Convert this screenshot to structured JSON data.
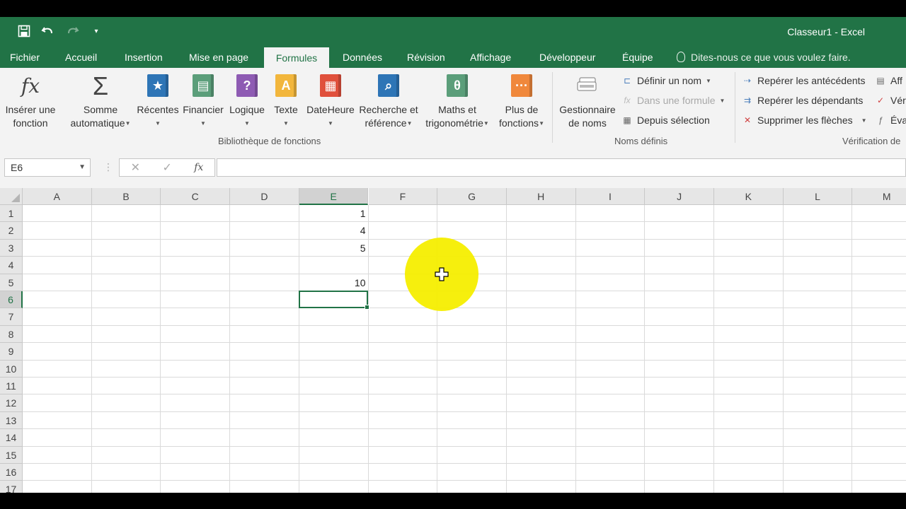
{
  "window": {
    "title": "Classeur1 - Excel"
  },
  "tabs": [
    {
      "label": "Fichier"
    },
    {
      "label": "Accueil"
    },
    {
      "label": "Insertion"
    },
    {
      "label": "Mise en page"
    },
    {
      "label": "Formules"
    },
    {
      "label": "Données"
    },
    {
      "label": "Révision"
    },
    {
      "label": "Affichage"
    },
    {
      "label": "Développeur"
    },
    {
      "label": "Équipe"
    }
  ],
  "active_tab": "Formules",
  "tell_me": "Dites-nous ce que vous voulez faire.",
  "ribbon": {
    "insert_function": {
      "line1": "Insérer une",
      "line2": "fonction"
    },
    "autosum": {
      "line1": "Somme",
      "line2": "automatique"
    },
    "recent": {
      "label": "Récentes"
    },
    "financial": {
      "label": "Financier"
    },
    "logical": {
      "label": "Logique"
    },
    "text": {
      "label": "Texte"
    },
    "datetime": {
      "label": "DateHeure"
    },
    "lookup": {
      "line1": "Recherche et",
      "line2": "référence"
    },
    "math": {
      "line1": "Maths et",
      "line2": "trigonométrie"
    },
    "more": {
      "line1": "Plus de",
      "line2": "fonctions"
    },
    "library_group": "Bibliothèque de fonctions",
    "name_manager": {
      "line1": "Gestionnaire",
      "line2": "de noms"
    },
    "define_name": "Définir un nom",
    "use_in_formula": "Dans une formule",
    "create_from_selection": "Depuis sélection",
    "names_group": "Noms définis",
    "trace_precedents": "Repérer les antécédents",
    "trace_dependents": "Repérer les dépendants",
    "remove_arrows": "Supprimer les flèches",
    "show_formulas": "Aff",
    "error_checking": "Vér",
    "evaluate": "Éva",
    "audit_group": "Vérification de"
  },
  "formula_bar": {
    "name_box": "E6",
    "fx": "fx",
    "value": ""
  },
  "columns": [
    "A",
    "B",
    "C",
    "D",
    "E",
    "F",
    "G",
    "H",
    "I",
    "J",
    "K",
    "L",
    "M"
  ],
  "rows": [
    "1",
    "2",
    "3",
    "4",
    "5",
    "6",
    "7",
    "8",
    "9",
    "10",
    "11",
    "12",
    "13",
    "14",
    "15",
    "16",
    "17"
  ],
  "cells": {
    "E1": "1",
    "E2": "4",
    "E3": "5",
    "E5": "10"
  },
  "selected_cell": "E6",
  "colors": {
    "excel_green": "#217346",
    "highlight": "#f5ee00"
  }
}
